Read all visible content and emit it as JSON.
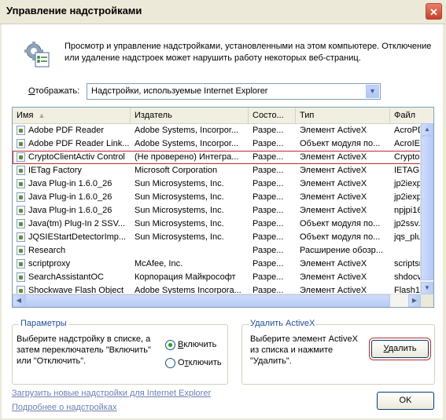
{
  "window": {
    "title": "Управление надстройками",
    "close": "✕"
  },
  "header": {
    "description": "Просмотр и управление надстройками, установленными на этом компьютере. Отключение или удаление надстроек может нарушить работу некоторых веб-страниц."
  },
  "filter": {
    "label_prefix": "О",
    "label_rest": "тображать:",
    "value": "Надстройки, используемые Internet Explorer"
  },
  "table": {
    "columns": [
      "Имя",
      "Издатель",
      "Состо...",
      "Тип",
      "Файл"
    ],
    "rows": [
      {
        "name": "Adobe PDF Reader",
        "publisher": "Adobe Systems, Incorpor...",
        "state": "Разре...",
        "type": "Элемент ActiveX",
        "file": "AcroPD"
      },
      {
        "name": "Adobe PDF Reader Link...",
        "publisher": "Adobe Systems, Incorpor...",
        "state": "Разре...",
        "type": "Объект модуля по...",
        "file": "AcroIEI"
      },
      {
        "name": "CryptoClientActiv Control",
        "publisher": "(Не проверено) Интегра...",
        "state": "Разре...",
        "type": "Элемент ActiveX",
        "file": "Crypto"
      },
      {
        "name": "IETag Factory",
        "publisher": "Microsoft Corporation",
        "state": "Разре...",
        "type": "Элемент ActiveX",
        "file": "IETAG."
      },
      {
        "name": "Java Plug-in 1.6.0_26",
        "publisher": "Sun Microsystems, Inc.",
        "state": "Разре...",
        "type": "Элемент ActiveX",
        "file": "jp2iexp"
      },
      {
        "name": "Java Plug-in 1.6.0_26",
        "publisher": "Sun Microsystems, Inc.",
        "state": "Разре...",
        "type": "Элемент ActiveX",
        "file": "jp2iexp"
      },
      {
        "name": "Java Plug-in 1.6.0_26",
        "publisher": "Sun Microsystems, Inc.",
        "state": "Разре...",
        "type": "Элемент ActiveX",
        "file": "npjpi16"
      },
      {
        "name": "Java(tm) Plug-In 2 SSV...",
        "publisher": "Sun Microsystems, Inc.",
        "state": "Разре...",
        "type": "Объект модуля по...",
        "file": "jp2ssv."
      },
      {
        "name": "JQSIEStartDetectorImp...",
        "publisher": "Sun Microsystems, Inc.",
        "state": "Разре...",
        "type": "Объект модуля по...",
        "file": "jqs_plu"
      },
      {
        "name": "Research",
        "publisher": "",
        "state": "Разре...",
        "type": "Расширение обозр...",
        "file": ""
      },
      {
        "name": "scriptproxy",
        "publisher": "McAfee, Inc.",
        "state": "Разре...",
        "type": "Элемент ActiveX",
        "file": "scriptsn"
      },
      {
        "name": "SearchAssistantOC",
        "publisher": "Корпорация Майкрософт",
        "state": "Разре...",
        "type": "Элемент ActiveX",
        "file": "shdocv"
      },
      {
        "name": "Shockwave Flash Object",
        "publisher": "Adobe Systems Incorpora...",
        "state": "Разре...",
        "type": "Элемент ActiveX",
        "file": "Flash10"
      }
    ]
  },
  "params": {
    "legend": "Параметры",
    "text": "Выберите надстройку в списке, а затем переключатель \"Включить\" или \"Отключить\".",
    "enable_prefix": "В",
    "enable_rest": "ключить",
    "disable_prefix": "О",
    "disable_mid": "т",
    "disable_rest": "ключить",
    "selected": "enable"
  },
  "remove": {
    "legend": "Удалить ActiveX",
    "text": "Выберите элемент ActiveX из списка и нажмите \"Удалить\".",
    "button_prefix": "У",
    "button_rest": "далить"
  },
  "links": {
    "download": "Загрузить новые надстройки для Internet Explorer",
    "more": "Подробнее о надстройках"
  },
  "ok": "OK"
}
